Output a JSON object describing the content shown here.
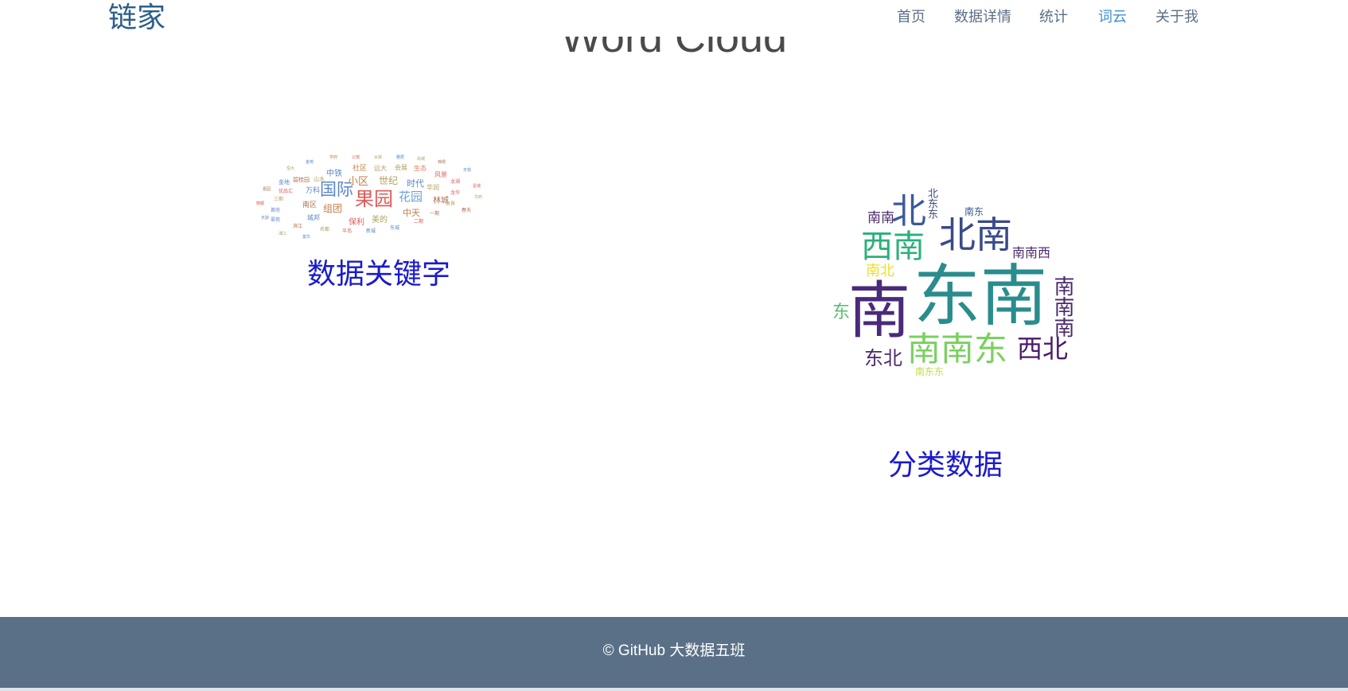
{
  "navbar": {
    "brand": "链家",
    "links": [
      {
        "label": "首页"
      },
      {
        "label": "数据详情"
      },
      {
        "label": "统计"
      },
      {
        "label": "词云",
        "active": true
      },
      {
        "label": "关于我"
      }
    ]
  },
  "page": {
    "heading": "Word Cloud"
  },
  "keyword_cloud": {
    "caption": "数据关键字",
    "words": [
      "果园",
      "国际",
      "花园",
      "小区",
      "世纪",
      "时代",
      "组团",
      "中天",
      "中铁",
      "林城",
      "保利",
      "美的",
      "万科",
      "南区",
      "城邦",
      "社区",
      "远大",
      "会展",
      "生态",
      "风景",
      "华润",
      "龙湖",
      "碧桂园",
      "金地",
      "山水",
      "优品汇",
      "三期",
      "首府",
      "龙华",
      "世界",
      "一期",
      "二期",
      "东城",
      "新城",
      "半岛",
      "名都",
      "滨江",
      "翠苑",
      "春天",
      "华府",
      "星城",
      "天悦",
      "锦绣",
      "尚城",
      "雅居",
      "水岸",
      "公馆",
      "学府",
      "金苑",
      "恒大",
      "嘉园",
      "丽都",
      "天骄",
      "湘江",
      "富华"
    ]
  },
  "direction_cloud": {
    "caption": "分类数据",
    "words": [
      "东南",
      "南",
      "北南",
      "西南",
      "北",
      "南南东",
      "西北",
      "东北",
      "南南",
      "南东",
      "南南西",
      "南北",
      "东",
      "南南南",
      "北东东",
      "南东东"
    ]
  },
  "footer": {
    "text": "© GitHub 大数据五班"
  },
  "colors": {
    "brand": "#2b5f8a",
    "nav_text": "#5b6f86",
    "nav_active": "#3b8fd1",
    "caption": "#1a1acc",
    "footer_bg": "#5a7087"
  }
}
